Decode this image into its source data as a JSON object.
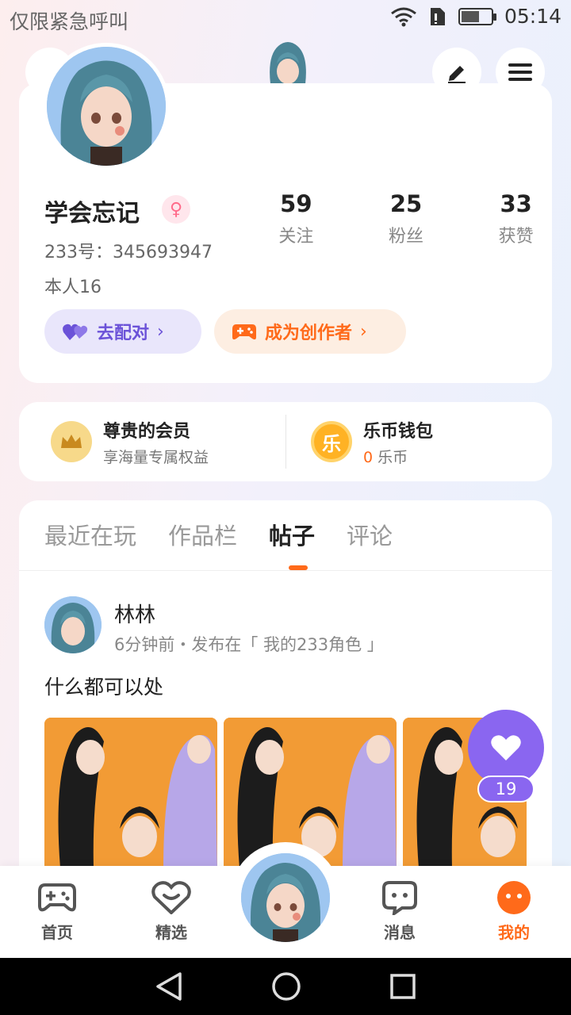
{
  "status": {
    "left_text": "仅限紧急呼叫",
    "time": "05:14",
    "battery_level": 0.6
  },
  "profile": {
    "name": "学会忘记",
    "gender_icon": "female-icon",
    "uid": "233号：345693947",
    "bio": "本人16",
    "stats": [
      {
        "value": "59",
        "label": "关注"
      },
      {
        "value": "25",
        "label": "粉丝"
      },
      {
        "value": "33",
        "label": "获赞"
      }
    ],
    "match_label": "去配对",
    "creator_label": "成为创作者"
  },
  "member": {
    "vip_title": "尊贵的会员",
    "vip_sub": "享海量专属权益",
    "wallet_title": "乐币钱包",
    "wallet_amount": "0",
    "wallet_unit": "乐币",
    "coin_glyph": "乐"
  },
  "tabs": [
    {
      "label": "最近在玩"
    },
    {
      "label": "作品栏"
    },
    {
      "label": "帖子"
    },
    {
      "label": "评论"
    }
  ],
  "post": {
    "author": "林林",
    "meta": "6分钟前・发布在「 我的233角色 」",
    "text": "什么都可以处",
    "likes": "19"
  },
  "nav": [
    {
      "label": "首页",
      "icon": "gamepad-icon"
    },
    {
      "label": "精选",
      "icon": "heart-chat-icon"
    },
    {
      "label": "消息",
      "icon": "message-icon"
    },
    {
      "label": "我的",
      "icon": "profile-icon"
    }
  ],
  "colors": {
    "accent": "#ff6a1a",
    "purple": "#8a66f0",
    "match": "#6b52d8"
  }
}
